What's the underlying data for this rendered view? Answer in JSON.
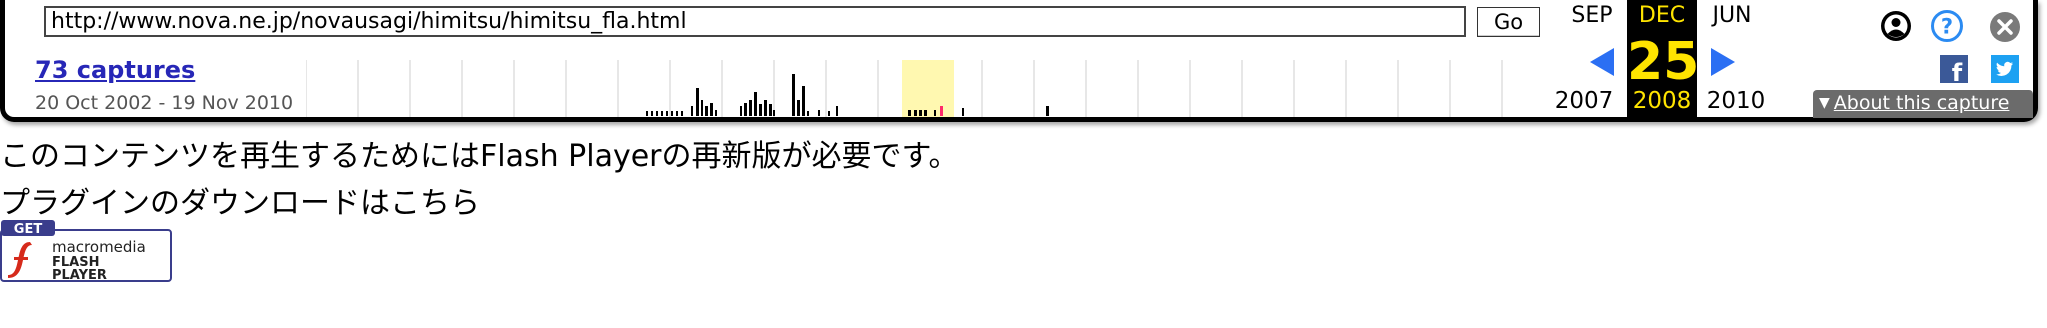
{
  "toolbar": {
    "url": "http://www.nova.ne.jp/novausagi/himitsu/himitsu_fla.html",
    "go_label": "Go",
    "captures_label": "73 captures",
    "capture_range": "20 Oct 2002 - 19 Nov 2010",
    "prev_month": "SEP",
    "current_month": "DEC",
    "next_month": "JUN",
    "current_day": "25",
    "prev_year": "2007",
    "current_year": "2008",
    "next_year": "2010",
    "about_label": "About this capture",
    "colors": {
      "accent_yellow": "#ffe400",
      "link_blue": "#2727b7",
      "arrow_blue": "#2b6ff3",
      "highlight": "#fff8b0",
      "facebook": "#3b5998",
      "twitter": "#1da1f2"
    },
    "icons": [
      "user-icon",
      "help-icon",
      "close-icon",
      "facebook-icon",
      "twitter-icon",
      "prev-arrow-icon",
      "next-arrow-icon"
    ]
  },
  "content": {
    "line1": "このコンテンツを再生するためにはFlash Playerの再新版が必要です。",
    "line2": "プラグインのダウンロードはこちら",
    "badge": {
      "get": "GET",
      "line1": "macromedia",
      "line2": "FLASH",
      "line3": "PLAYER"
    }
  }
}
